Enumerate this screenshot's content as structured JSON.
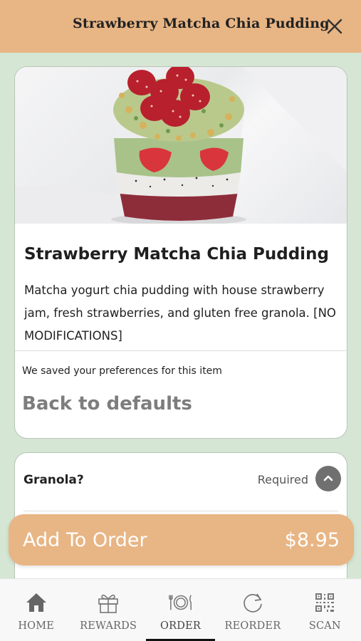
{
  "header": {
    "title": "Strawberry Matcha Chia Pudding"
  },
  "item": {
    "title": "Strawberry Matcha Chia Pudding",
    "description": "Matcha yogurt chia pudding with house strawberry jam, fresh strawberries, and gluten free granola. [NO MODIFICATIONS]",
    "saved_text": "We saved your preferences for this item",
    "back_defaults": "Back to defaults"
  },
  "option": {
    "label": "Granola?",
    "required": "Required"
  },
  "order_button": {
    "label": "Add To Order",
    "price": "$8.95"
  },
  "nav": {
    "items": [
      {
        "label": "HOME",
        "icon": "home-icon"
      },
      {
        "label": "REWARDS",
        "icon": "gift-icon"
      },
      {
        "label": "ORDER",
        "icon": "plate-cutlery-icon",
        "active": true
      },
      {
        "label": "REORDER",
        "icon": "reorder-icon"
      },
      {
        "label": "SCAN",
        "icon": "qr-code-icon"
      }
    ]
  },
  "colors": {
    "header": "#e8b584",
    "background": "#d6e6d4",
    "accent": "#e8b584"
  }
}
